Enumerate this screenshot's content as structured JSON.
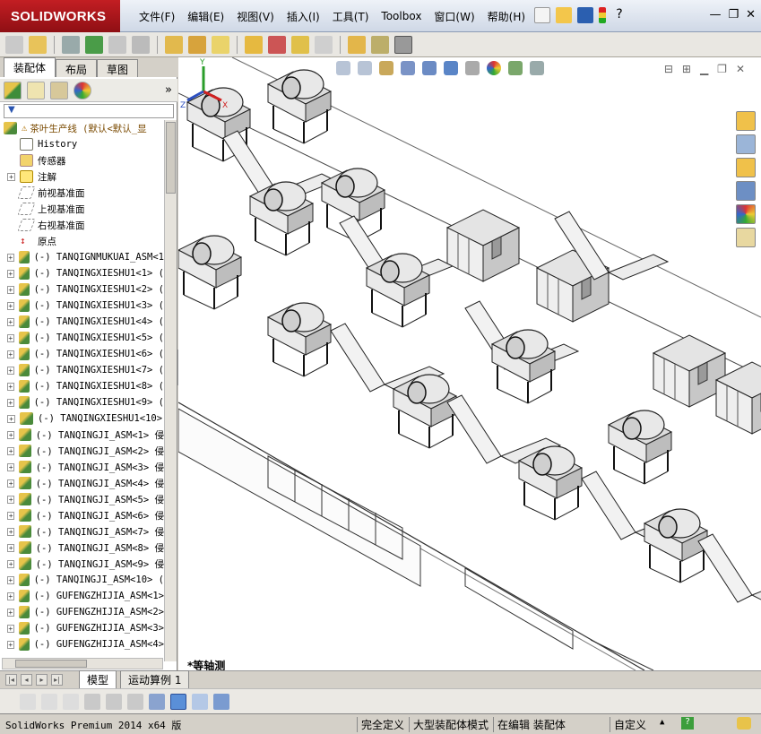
{
  "app": {
    "logo_text": "SOLIDWORKS"
  },
  "menu": {
    "items": [
      "文件(F)",
      "编辑(E)",
      "视图(V)",
      "插入(I)",
      "工具(T)",
      "Toolbox",
      "窗口(W)",
      "帮助(H)"
    ]
  },
  "window_controls": [
    "—",
    "❐",
    "✕"
  ],
  "panel_tabs": [
    "装配体",
    "布局",
    "草图"
  ],
  "tree": {
    "root_label": "茶叶生产线  (默认<默认_显",
    "items": [
      {
        "label": "History",
        "icon": "history-icon",
        "expandable": false
      },
      {
        "label": "传感器",
        "icon": "sensor-icon",
        "expandable": false
      },
      {
        "label": "注解",
        "icon": "annotation-icon",
        "expandable": true
      },
      {
        "label": "前视基准面",
        "icon": "plane-icon",
        "expandable": false
      },
      {
        "label": "上视基准面",
        "icon": "plane-icon",
        "expandable": false
      },
      {
        "label": "右视基准面",
        "icon": "plane-icon",
        "expandable": false
      },
      {
        "label": "原点",
        "icon": "origin-icon",
        "expandable": false
      },
      {
        "label": "(-) TANQIGNMUKUAI_ASM<1",
        "icon": "assembly-icon",
        "expandable": true
      },
      {
        "label": "(-) TANQINGXIESHU1<1> (",
        "icon": "assembly-icon",
        "expandable": true
      },
      {
        "label": "(-) TANQINGXIESHU1<2> (",
        "icon": "assembly-icon",
        "expandable": true
      },
      {
        "label": "(-) TANQINGXIESHU1<3> (",
        "icon": "assembly-icon",
        "expandable": true
      },
      {
        "label": "(-) TANQINGXIESHU1<4> (",
        "icon": "assembly-icon",
        "expandable": true
      },
      {
        "label": "(-) TANQINGXIESHU1<5> (",
        "icon": "assembly-icon",
        "expandable": true
      },
      {
        "label": "(-) TANQINGXIESHU1<6> (",
        "icon": "assembly-icon",
        "expandable": true
      },
      {
        "label": "(-) TANQINGXIESHU1<7> (",
        "icon": "assembly-icon",
        "expandable": true
      },
      {
        "label": "(-) TANQINGXIESHU1<8> (",
        "icon": "assembly-icon",
        "expandable": true
      },
      {
        "label": "(-) TANQINGXIESHU1<9> (",
        "icon": "assembly-icon",
        "expandable": true
      },
      {
        "label": "(-) TANQINGXIESHU1<10>",
        "icon": "assembly-icon",
        "expandable": true
      },
      {
        "label": "(-) TANQINGJI_ASM<1> 侵",
        "icon": "assembly-icon",
        "expandable": true
      },
      {
        "label": "(-) TANQINGJI_ASM<2> 侵",
        "icon": "assembly-icon",
        "expandable": true
      },
      {
        "label": "(-) TANQINGJI_ASM<3> 侵",
        "icon": "assembly-icon",
        "expandable": true
      },
      {
        "label": "(-) TANQINGJI_ASM<4> 侵",
        "icon": "assembly-icon",
        "expandable": true
      },
      {
        "label": "(-) TANQINGJI_ASM<5> 侵",
        "icon": "assembly-icon",
        "expandable": true
      },
      {
        "label": "(-) TANQINGJI_ASM<6> 侵",
        "icon": "assembly-icon",
        "expandable": true
      },
      {
        "label": "(-) TANQINGJI_ASM<7> 侵",
        "icon": "assembly-icon",
        "expandable": true
      },
      {
        "label": "(-) TANQINGJI_ASM<8> 侵",
        "icon": "assembly-icon",
        "expandable": true
      },
      {
        "label": "(-) TANQINGJI_ASM<9> 侵",
        "icon": "assembly-icon",
        "expandable": true
      },
      {
        "label": "(-) TANQINGJI_ASM<10> (",
        "icon": "assembly-icon",
        "expandable": true
      },
      {
        "label": "(-) GUFENGZHIJIA_ASM<1>",
        "icon": "assembly-icon",
        "expandable": true
      },
      {
        "label": "(-) GUFENGZHIJIA_ASM<2>",
        "icon": "assembly-icon",
        "expandable": true
      },
      {
        "label": "(-) GUFENGZHIJIA_ASM<3>",
        "icon": "assembly-icon",
        "expandable": true
      },
      {
        "label": "(-) GUFENGZHIJIA_ASM<4>",
        "icon": "assembly-icon",
        "expandable": true
      }
    ]
  },
  "viewport": {
    "view_name": "*等轴测",
    "triad": {
      "x": "X",
      "y": "Y",
      "z": "Z"
    }
  },
  "bottom_tabs": [
    "模型",
    "运动算例 1"
  ],
  "status": {
    "product": "SolidWorks Premium 2014 x64 版",
    "fields": [
      "完全定义",
      "大型装配体模式",
      "在编辑 装配体",
      "自定义"
    ]
  },
  "colors": {
    "title_bg": "#dde4ee",
    "logo_red": "#b71c20",
    "viewport_bg": "#ffffff",
    "machine_grey": "#dcdcdc",
    "machine_outline": "#222222"
  }
}
